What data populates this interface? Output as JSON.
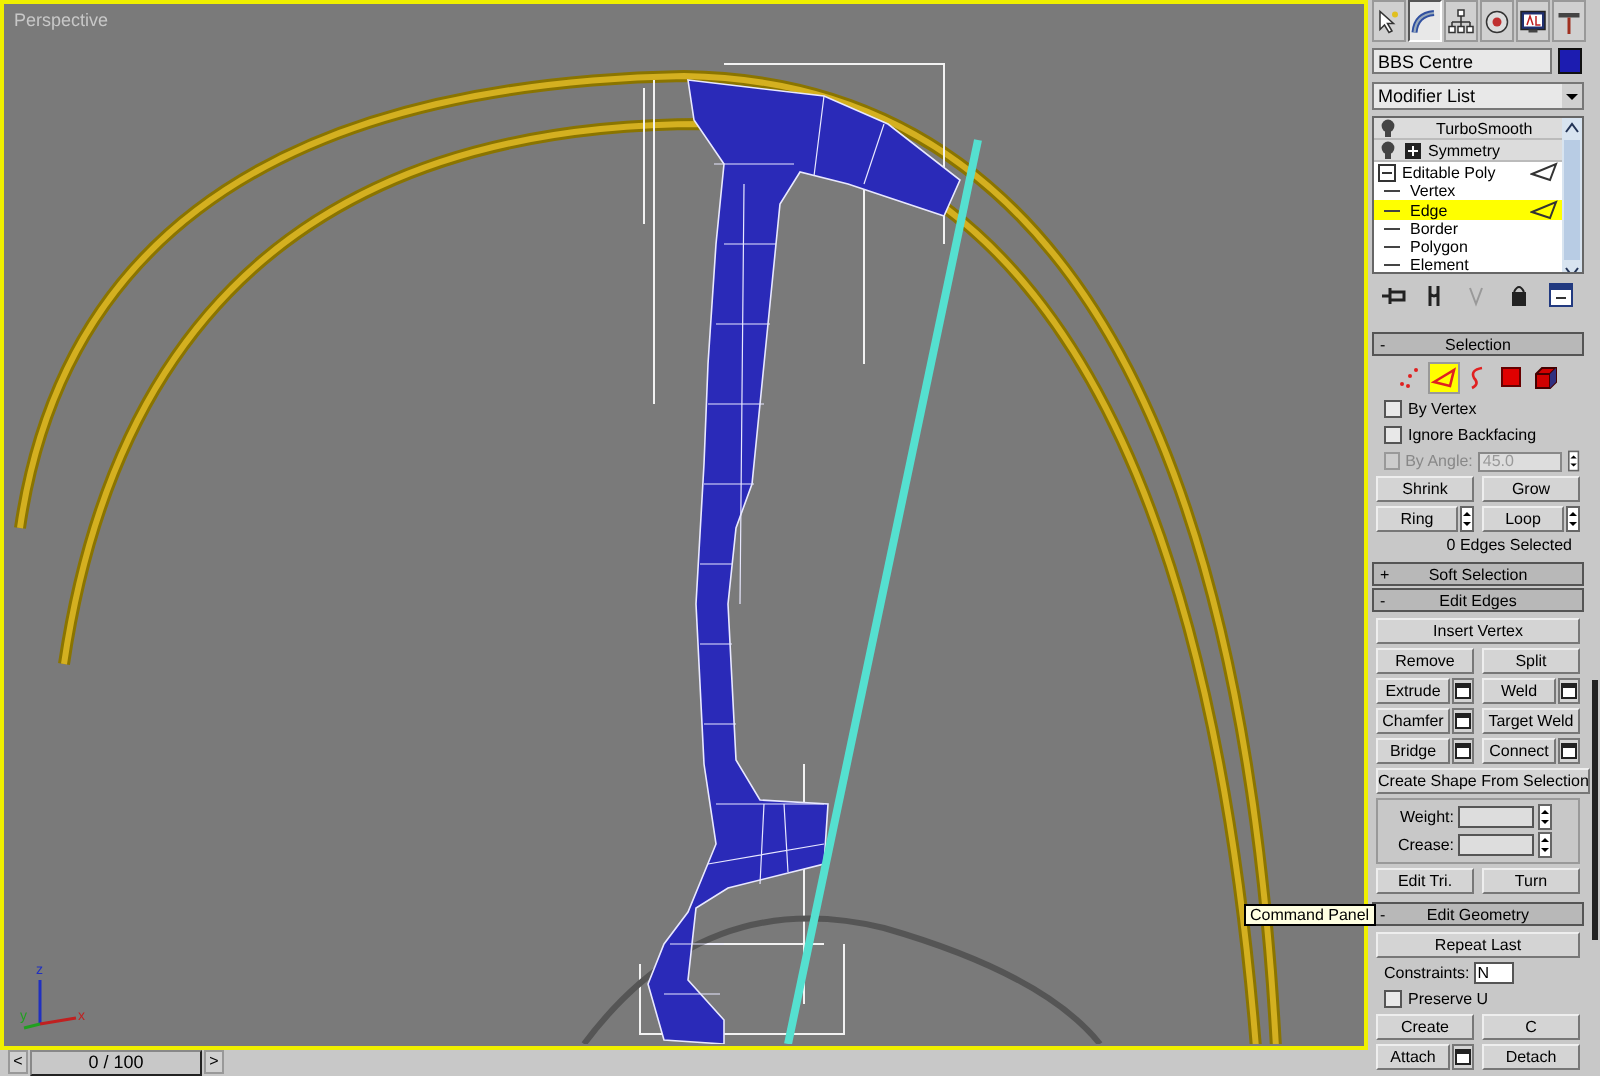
{
  "viewport": {
    "label": "Perspective",
    "active": true,
    "axis_labels": [
      "z",
      "y",
      "x"
    ]
  },
  "timeline": {
    "prev": "<",
    "position": "0 / 100",
    "next": ">",
    "level": 0
  },
  "command_panel": {
    "tabs": [
      {
        "kind": "create",
        "selected": false
      },
      {
        "kind": "modify",
        "selected": true
      },
      {
        "kind": "hierarchy",
        "selected": false
      },
      {
        "kind": "motion",
        "selected": false
      },
      {
        "kind": "display",
        "selected": false
      },
      {
        "kind": "utilities",
        "selected": false
      }
    ],
    "object_name": "BBS Centre",
    "modifier_list": "Modifier List",
    "stack": [
      {
        "label": "TurboSmooth",
        "kind": "modifier"
      },
      {
        "label": "Symmetry",
        "kind": "collapsed"
      },
      {
        "label": "Editable Poly",
        "kind": "base",
        "children": [
          {
            "label": "Vertex",
            "selected": false
          },
          {
            "label": "Edge",
            "selected": true
          },
          {
            "label": "Border",
            "selected": false
          },
          {
            "label": "Polygon",
            "selected": false
          },
          {
            "label": "Element",
            "selected": false
          }
        ]
      }
    ],
    "rollouts": [
      {
        "sign": "-",
        "title": "Selection",
        "kind": "selection",
        "subobjects": [
          {
            "kind": "vertex",
            "selected": false
          },
          {
            "kind": "edge",
            "selected": true
          },
          {
            "kind": "border",
            "selected": false
          },
          {
            "kind": "polygon",
            "selected": false
          },
          {
            "kind": "element",
            "selected": false
          }
        ],
        "checks": [
          {
            "label": "By Vertex",
            "checked": false
          },
          {
            "label": "Ignore Backfacing",
            "checked": false
          },
          {
            "label": "By Angle:",
            "checked": false,
            "disabled": true,
            "value": "45.0"
          }
        ],
        "rows": [
          [
            {
              "label": "Shrink"
            },
            {
              "label": "Grow"
            }
          ],
          [
            {
              "label": "Ring",
              "spinner": true
            },
            {
              "label": "Loop",
              "spinner": true
            }
          ]
        ],
        "status": "0 Edges Selected"
      },
      {
        "sign": "+",
        "title": "Soft Selection",
        "kind": "header"
      },
      {
        "sign": "-",
        "title": "Edit Edges",
        "kind": "edges",
        "rows": [
          [
            {
              "label": "Insert Vertex"
            }
          ],
          [
            {
              "label": "Remove"
            },
            {
              "label": "Split"
            }
          ],
          [
            {
              "label": "Extrude",
              "settings": true
            },
            {
              "label": "Weld",
              "settings": true
            }
          ],
          [
            {
              "label": "Chamfer",
              "settings": true
            },
            {
              "label": "Target Weld"
            }
          ],
          [
            {
              "label": "Bridge",
              "settings": true
            },
            {
              "label": "Connect",
              "settings": true
            }
          ],
          [
            {
              "label": "Create Shape From Selection"
            }
          ]
        ],
        "fields": [
          {
            "label": "Weight:"
          },
          {
            "label": "Crease:"
          }
        ],
        "rows2": [
          [
            {
              "label": "Edit Tri."
            },
            {
              "label": "Turn"
            }
          ]
        ]
      },
      {
        "sign": "-",
        "title": "Edit Geometry",
        "kind": "geometry",
        "rows": [
          [
            {
              "label": "Repeat Last"
            }
          ]
        ],
        "constraints": {
          "label": "Constraints:",
          "value": "N"
        },
        "check": {
          "label": "Preserve U",
          "checked": false
        },
        "rows2": [
          [
            {
              "label": "Create"
            },
            {
              "label": "C"
            }
          ],
          [
            {
              "label": "Attach",
              "settings": true
            },
            {
              "label": "Detach"
            }
          ]
        ]
      }
    ]
  },
  "tooltip": "Command Panel"
}
